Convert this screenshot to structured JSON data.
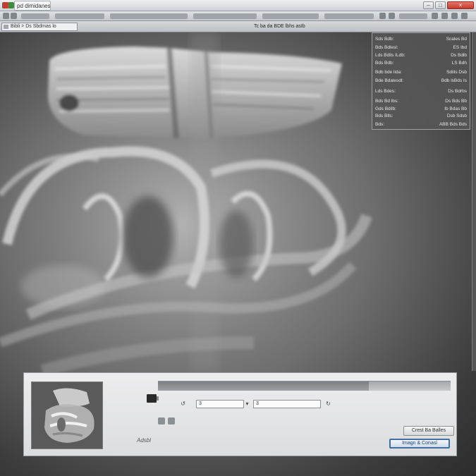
{
  "window": {
    "title": "pd dimidanes",
    "minimize_label": "–",
    "close_label": "×"
  },
  "toolbar": {
    "path_text": "Bibli > Ds Sbdmas lo",
    "view_title": "Tc ba da BDE lbhs asIb"
  },
  "info_panel": {
    "rows": [
      {
        "key": "Sds Bdb:",
        "value": "Scales Bd"
      },
      {
        "key": "Bds Bdlesl:",
        "value": "ES Ibd"
      },
      {
        "key": "Lds Bdlis ILdb:",
        "value": "Ds Bdlb"
      },
      {
        "key": "Bds Bdb:",
        "value": "LS Bdh"
      },
      {
        "key": "Bdb bde lida:",
        "value": "Sdiils Dsb"
      },
      {
        "key": "Bde Bdalesdl:",
        "value": "Bdb lsBds Is"
      },
      {
        "key": "Lds Bdes:",
        "value": "Ds Bdrbs"
      },
      {
        "key": "Bds Bd lbs:",
        "value": "Ds Bds Bb"
      },
      {
        "key": "Gds Bdilb:",
        "value": "Ib Bdas Bb"
      },
      {
        "key": "Bds Blls:",
        "value": "Dsb Sdsb"
      },
      {
        "key": "Bds:",
        "value": "ABB Bds Bds"
      }
    ]
  },
  "dialog": {
    "progress": 0.72,
    "row1_value_a": "3",
    "row1_value_b": "3",
    "secondary_button": "Crest Ba Balles",
    "primary_button": "Imagn & Conasl",
    "footer_label": "Adsbl"
  },
  "colors": {
    "titlebar": "#cfd3d7",
    "close_button": "#c53a2e",
    "primary_border": "#3f6fa3"
  }
}
